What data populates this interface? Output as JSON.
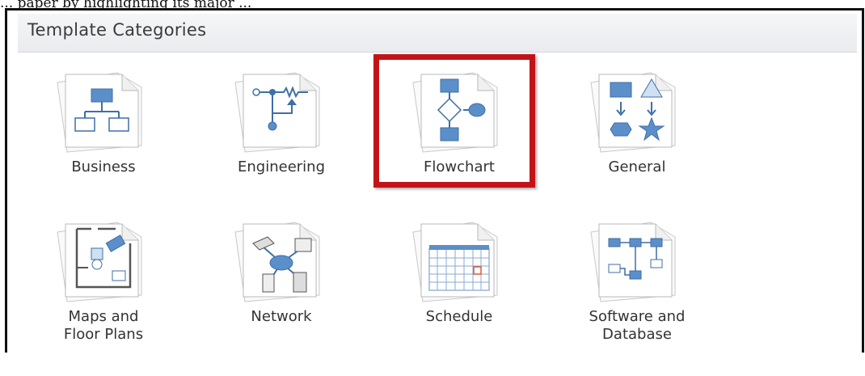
{
  "caption": "... paper by highlighting its major ...",
  "panel": {
    "title": "Template Categories"
  },
  "categories": [
    {
      "label": "Business",
      "icon": "business-org-chart-icon"
    },
    {
      "label": "Engineering",
      "icon": "engineering-circuit-icon"
    },
    {
      "label": "Flowchart",
      "icon": "flowchart-icon",
      "highlighted": true
    },
    {
      "label": "General",
      "icon": "general-shapes-icon"
    },
    {
      "label": "Maps and\nFloor Plans",
      "icon": "floor-plan-icon"
    },
    {
      "label": "Network",
      "icon": "network-icon"
    },
    {
      "label": "Schedule",
      "icon": "calendar-icon"
    },
    {
      "label": "Software and\nDatabase",
      "icon": "software-database-icon"
    }
  ],
  "colors": {
    "highlight": "#c21418",
    "icon_blue": "#5b8fc9"
  }
}
